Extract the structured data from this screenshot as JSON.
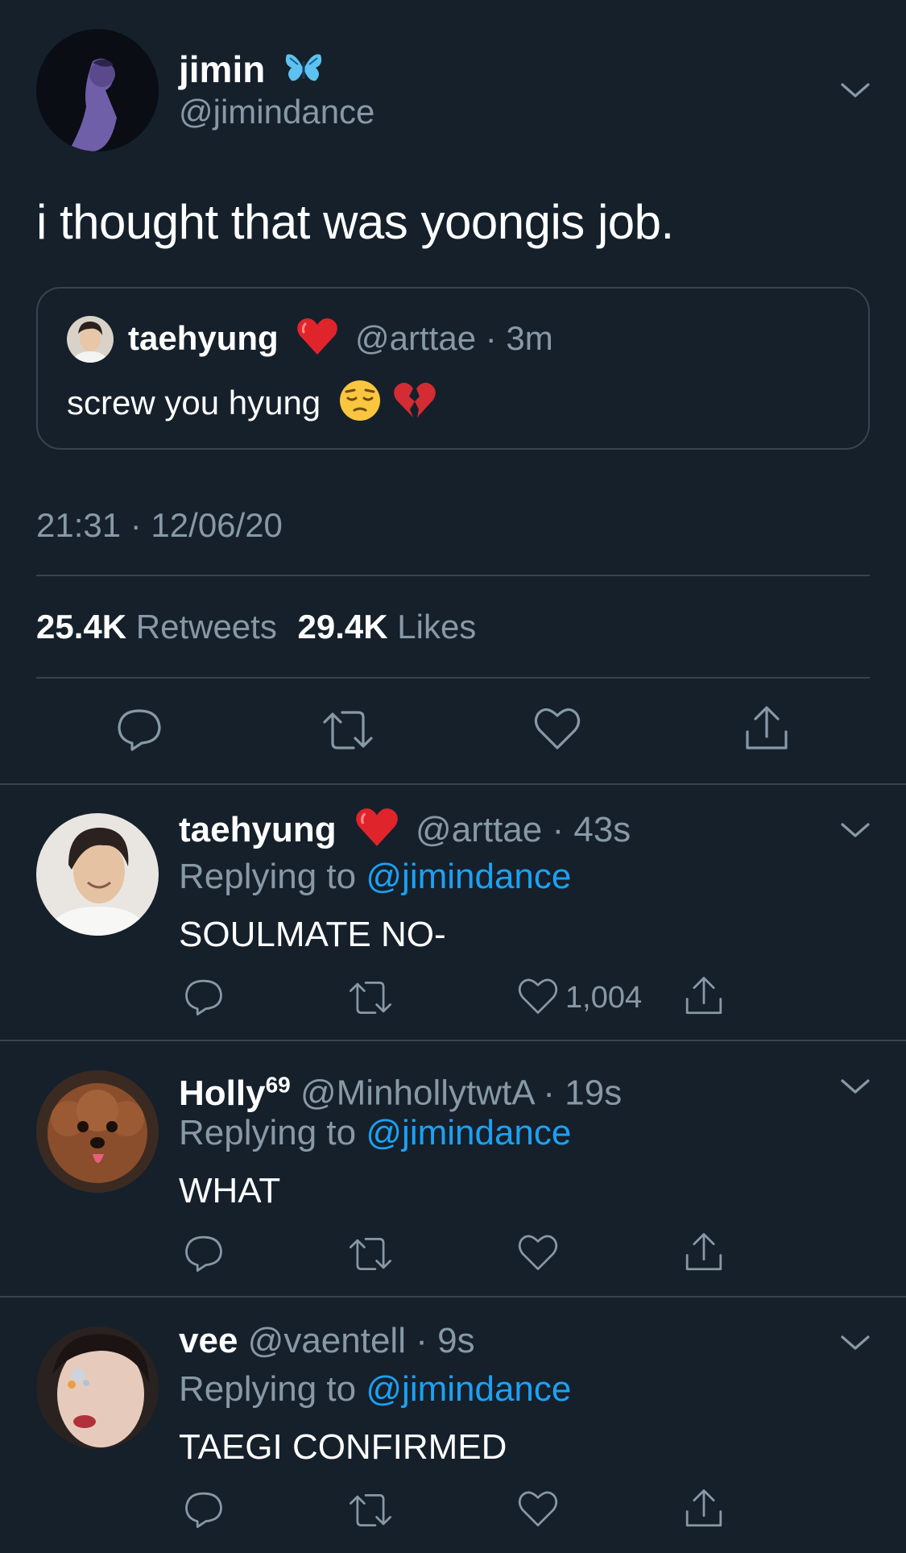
{
  "main_tweet": {
    "display_name": "jimin",
    "name_emoji": "butterfly",
    "handle": "@jimindance",
    "text": "i thought that was yoongis job.",
    "quoted": {
      "display_name": "taehyung",
      "name_emoji": "red-heart",
      "handle": "@arttae",
      "sep": "·",
      "time": "3m",
      "text": "screw you hyung",
      "text_emojis": [
        "pensive-face",
        "broken-heart"
      ]
    },
    "timestamp": "21:31 · 12/06/20",
    "retweets_count": "25.4K",
    "retweets_label": "Retweets",
    "likes_count": "29.4K",
    "likes_label": "Likes"
  },
  "replies": [
    {
      "display_name": "taehyung",
      "name_emoji": "red-heart",
      "handle": "@arttae",
      "sep": "·",
      "time": "43s",
      "replying_label": "Replying to",
      "replying_to": "@jimindance",
      "text": "SOULMATE NO-",
      "like_count": "1,004"
    },
    {
      "display_name": "Holly",
      "name_sup": "69",
      "handle": "@MinhollytwtA",
      "sep": "·",
      "time": "19s",
      "replying_label": "Replying to",
      "replying_to": "@jimindance",
      "text": "WHAT",
      "like_count": ""
    },
    {
      "display_name": "vee",
      "handle": "@vaentell",
      "sep": "·",
      "time": "9s",
      "replying_label": "Replying to",
      "replying_to": "@jimindance",
      "text": "TAEGI CONFIRMED",
      "like_count": ""
    }
  ],
  "colors": {
    "background": "#15202b",
    "text": "#ffffff",
    "muted": "#8899a6",
    "link": "#1da1f2",
    "divider": "#38444d"
  },
  "icons": [
    "chevron-down-icon",
    "reply-icon",
    "retweet-icon",
    "like-icon",
    "share-icon"
  ]
}
